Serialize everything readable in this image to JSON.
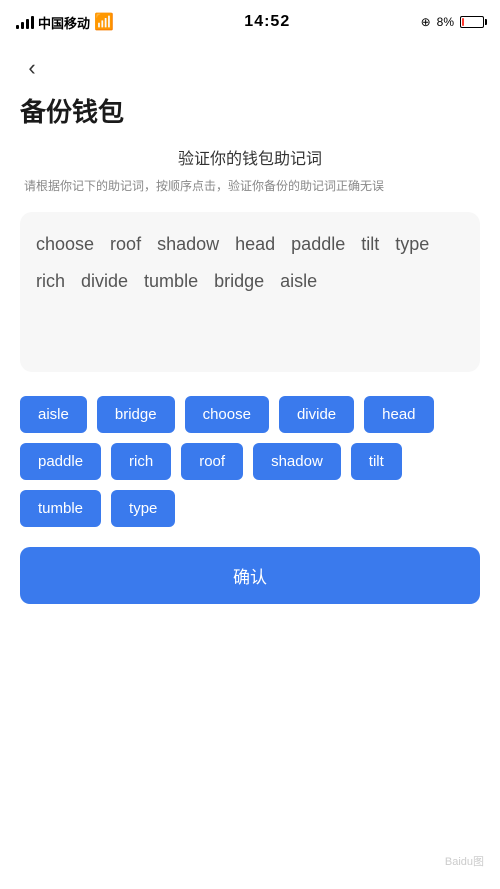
{
  "statusBar": {
    "carrier": "中国移动",
    "time": "14:52",
    "batteryPercent": "8%"
  },
  "back": "‹",
  "pageTitle": "备份钱包",
  "verifySection": {
    "heading": "验证你的钱包助记词",
    "description": "请根据你记下的助记词，按顺序点击，验证你备份的助记词正确无误"
  },
  "displayWords": [
    "choose",
    "roof",
    "shadow",
    "head",
    "paddle",
    "tilt",
    "type",
    "rich",
    "divide",
    "tumble",
    "bridge",
    "aisle"
  ],
  "wordButtons": [
    "aisle",
    "bridge",
    "choose",
    "divide",
    "head",
    "paddle",
    "rich",
    "roof",
    "shadow",
    "tilt",
    "tumble",
    "type"
  ],
  "confirmBtn": "确认"
}
